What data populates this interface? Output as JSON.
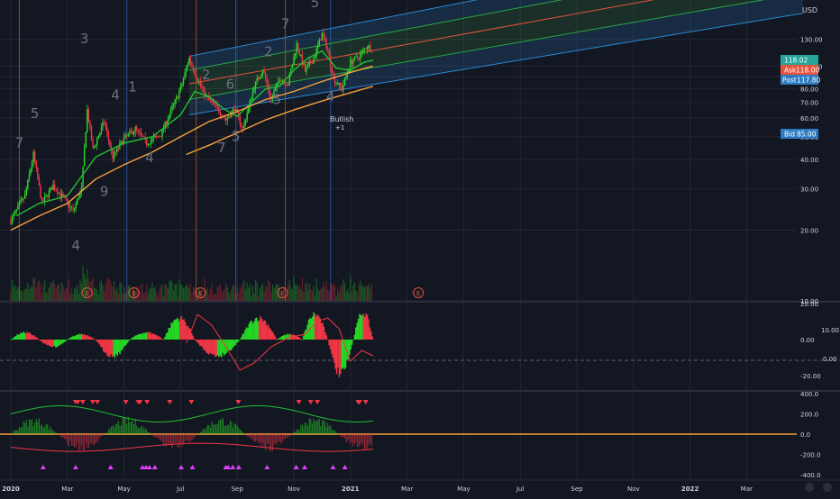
{
  "currency": "USD",
  "colors": {
    "background": "#131722",
    "grid": "#232735",
    "up": "#26d926",
    "down": "#f23645",
    "sma_green": "#22c132",
    "sma_orange": "#f7a13a",
    "channel_blue": "#2c8ad6",
    "channel_green": "#28a745",
    "channel_red": "#e5533d",
    "wave_label": "#6c7280",
    "text": "#d1d4dc"
  },
  "labels": {
    "ask_label": "Ask",
    "ask_value": "118.00",
    "last_value": "118.02",
    "post_label": "Post",
    "post_value": "117.80",
    "bid_label": "Bid",
    "bid_value": "85.00",
    "bullish_text": "Bullish",
    "bullish_sub": "+1",
    "earnings_marker": "E",
    "macd_right_label": "10.00",
    "macd_zero_right_label": "0.00"
  },
  "chart_data": [
    {
      "type": "candlestick",
      "panel": "price",
      "currency": "USD",
      "scale": "log",
      "y_ticks": [
        10,
        20,
        30,
        40,
        50,
        60,
        70,
        80,
        90,
        100,
        130
      ],
      "y_tick_labels": [
        "10.00",
        "20.00",
        "30.00",
        "40.00",
        "50.00",
        "60.00",
        "70.00",
        "80.00",
        "90.00",
        "100.00",
        "130.00"
      ],
      "x_tick_labels": [
        "2020",
        "Mar",
        "May",
        "Jul",
        "Sep",
        "Nov",
        "2021",
        "Mar",
        "May",
        "Jul",
        "Sep",
        "Nov",
        "2022",
        "Mar"
      ],
      "x_tick_months": [
        0,
        2,
        4,
        6,
        8,
        10,
        12,
        14,
        16,
        18,
        20,
        22,
        24,
        26
      ],
      "approx_close_path": [
        {
          "month": 0.0,
          "price": 22
        },
        {
          "month": 0.5,
          "price": 28
        },
        {
          "month": 0.8,
          "price": 42
        },
        {
          "month": 1.1,
          "price": 26
        },
        {
          "month": 1.5,
          "price": 31
        },
        {
          "month": 1.9,
          "price": 27
        },
        {
          "month": 2.2,
          "price": 24
        },
        {
          "month": 2.5,
          "price": 30
        },
        {
          "month": 2.7,
          "price": 65
        },
        {
          "month": 2.9,
          "price": 44
        },
        {
          "month": 3.3,
          "price": 58
        },
        {
          "month": 3.6,
          "price": 41
        },
        {
          "month": 4.0,
          "price": 49
        },
        {
          "month": 4.4,
          "price": 54
        },
        {
          "month": 4.8,
          "price": 47
        },
        {
          "month": 5.3,
          "price": 51
        },
        {
          "month": 5.7,
          "price": 66
        },
        {
          "month": 6.0,
          "price": 80
        },
        {
          "month": 6.3,
          "price": 108
        },
        {
          "month": 6.6,
          "price": 88
        },
        {
          "month": 6.9,
          "price": 74
        },
        {
          "month": 7.3,
          "price": 66
        },
        {
          "month": 7.6,
          "price": 59
        },
        {
          "month": 7.9,
          "price": 66
        },
        {
          "month": 8.2,
          "price": 54
        },
        {
          "month": 8.6,
          "price": 82
        },
        {
          "month": 8.9,
          "price": 97
        },
        {
          "month": 9.2,
          "price": 72
        },
        {
          "month": 9.5,
          "price": 89
        },
        {
          "month": 9.8,
          "price": 84
        },
        {
          "month": 10.1,
          "price": 124
        },
        {
          "month": 10.4,
          "price": 95
        },
        {
          "month": 10.7,
          "price": 108
        },
        {
          "month": 11.0,
          "price": 137
        },
        {
          "month": 11.2,
          "price": 117
        },
        {
          "month": 11.4,
          "price": 89
        },
        {
          "month": 11.7,
          "price": 80
        },
        {
          "month": 12.0,
          "price": 104
        },
        {
          "month": 12.3,
          "price": 110
        },
        {
          "month": 12.6,
          "price": 122
        },
        {
          "month": 12.8,
          "price": 118
        }
      ],
      "moving_averages": [
        {
          "name": "",
          "color": "#22c132",
          "points": [
            [
              0.2,
              23
            ],
            [
              1,
              26
            ],
            [
              2,
              28
            ],
            [
              3,
              41
            ],
            [
              4,
              47
            ],
            [
              5,
              50
            ],
            [
              6,
              62
            ],
            [
              6.5,
              78
            ],
            [
              7,
              74
            ],
            [
              7.5,
              66
            ],
            [
              8,
              61
            ],
            [
              8.5,
              70
            ],
            [
              9,
              80
            ],
            [
              9.5,
              82
            ],
            [
              10,
              96
            ],
            [
              10.5,
              108
            ],
            [
              11,
              116
            ],
            [
              11.5,
              98
            ],
            [
              12,
              96
            ],
            [
              12.5,
              104
            ],
            [
              12.8,
              106
            ]
          ]
        },
        {
          "name": "",
          "color": "#f7a13a",
          "points": [
            [
              0,
              20
            ],
            [
              1,
              23
            ],
            [
              2,
              26
            ],
            [
              3,
              33
            ],
            [
              4,
              38
            ],
            [
              5,
              43
            ],
            [
              6,
              50
            ],
            [
              7,
              58
            ],
            [
              8,
              64
            ],
            [
              9,
              72
            ],
            [
              10,
              78
            ],
            [
              11,
              86
            ],
            [
              12,
              94
            ],
            [
              12.8,
              100
            ]
          ]
        },
        {
          "name": "",
          "color": "#f7a13a",
          "points": [
            [
              6.2,
              42
            ],
            [
              7,
              46
            ],
            [
              8,
              52
            ],
            [
              9,
              59
            ],
            [
              10,
              65
            ],
            [
              11,
              71
            ],
            [
              12,
              77
            ],
            [
              12.8,
              82
            ]
          ]
        }
      ],
      "pitchfork_channel": {
        "start_month": 6.3,
        "end_month": 28,
        "upper": [
          110,
          360
        ],
        "upper_mid": [
          96,
          300
        ],
        "median": [
          84,
          250
        ],
        "lower_mid": [
          72,
          205
        ],
        "lower": [
          62,
          168
        ]
      },
      "wave_labels": [
        {
          "text": "7",
          "month": 0.3,
          "price": 45
        },
        {
          "text": "5",
          "month": 0.85,
          "price": 60
        },
        {
          "text": "4",
          "month": 2.3,
          "price": 16.5
        },
        {
          "text": "3",
          "month": 2.6,
          "price": 125
        },
        {
          "text": "9",
          "month": 3.3,
          "price": 28
        },
        {
          "text": "4",
          "month": 3.7,
          "price": 72
        },
        {
          "text": "1",
          "month": 4.3,
          "price": 78
        },
        {
          "text": "4",
          "month": 4.9,
          "price": 39
        },
        {
          "text": "2",
          "month": 6.9,
          "price": 88
        },
        {
          "text": "6",
          "month": 7.75,
          "price": 80
        },
        {
          "text": "7",
          "month": 7.45,
          "price": 43
        },
        {
          "text": "5",
          "month": 7.95,
          "price": 48
        },
        {
          "text": "2",
          "month": 9.1,
          "price": 110
        },
        {
          "text": "5",
          "month": 9.4,
          "price": 69
        },
        {
          "text": "7",
          "month": 9.7,
          "price": 145
        },
        {
          "text": "5",
          "month": 10.75,
          "price": 178
        },
        {
          "text": "4",
          "month": 11.3,
          "price": 71
        }
      ],
      "earnings_months": [
        2.7,
        4.35,
        6.7,
        9.6,
        14.4
      ],
      "vertical_markers": [
        {
          "month": 0.3,
          "color": "#a65a2a"
        },
        {
          "month": 4.1,
          "color": "#2b63b5"
        },
        {
          "month": 6.55,
          "color": "#a65a2a"
        },
        {
          "month": 7.95,
          "color": "#2b63b5"
        },
        {
          "month": 9.7,
          "color": "#a65a2a"
        },
        {
          "month": 11.3,
          "color": "#2b63b5"
        }
      ],
      "last_price": 118.02
    },
    {
      "type": "bar",
      "panel": "oscillator",
      "y_ticks": [
        20,
        0,
        -20
      ],
      "y_tick_labels": [
        "20.00",
        "0.00",
        "-20.00"
      ],
      "histogram_cycles": [
        {
          "from": 0.0,
          "to": 1.0,
          "amp": 4
        },
        {
          "from": 1.0,
          "to": 2.0,
          "amp": -4
        },
        {
          "from": 2.0,
          "to": 3.0,
          "amp": 3
        },
        {
          "from": 3.0,
          "to": 4.2,
          "amp": -9
        },
        {
          "from": 4.2,
          "to": 5.4,
          "amp": 4
        },
        {
          "from": 5.4,
          "to": 6.5,
          "amp": 12
        },
        {
          "from": 6.5,
          "to": 8.1,
          "amp": -9
        },
        {
          "from": 8.1,
          "to": 9.4,
          "amp": 12
        },
        {
          "from": 9.4,
          "to": 10.3,
          "amp": 3
        },
        {
          "from": 10.3,
          "to": 11.2,
          "amp": 14
        },
        {
          "from": 11.2,
          "to": 12.1,
          "amp": -19
        },
        {
          "from": 12.1,
          "to": 12.8,
          "amp": 15
        }
      ],
      "signal_line": [
        [
          6.2,
          -2
        ],
        [
          6.6,
          14
        ],
        [
          7.1,
          8
        ],
        [
          7.6,
          -4
        ],
        [
          8.1,
          -17
        ],
        [
          8.6,
          -13
        ],
        [
          9.2,
          -4
        ],
        [
          9.8,
          1
        ],
        [
          10.4,
          3
        ],
        [
          10.8,
          10
        ],
        [
          11.2,
          12
        ],
        [
          11.6,
          6
        ],
        [
          12.0,
          -12
        ],
        [
          12.4,
          -6
        ],
        [
          12.8,
          -9
        ]
      ],
      "signal_line_color": "#f23645"
    },
    {
      "type": "bar",
      "panel": "indicator",
      "y_ticks": [
        400,
        200,
        0,
        -200,
        -400
      ],
      "y_tick_labels": [
        "400.0",
        "200.0",
        "0.0",
        "-200.0",
        "-400.0"
      ],
      "zero_line_color": "#f7a13a"
    }
  ]
}
